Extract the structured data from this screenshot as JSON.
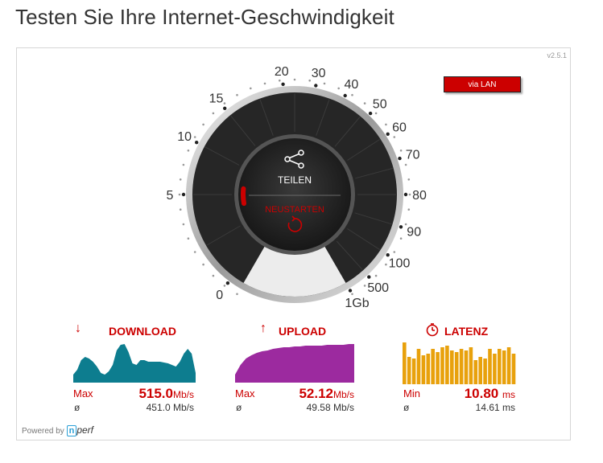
{
  "page": {
    "title": "Testen Sie Ihre Internet-Geschwindigkeit"
  },
  "panel": {
    "version": "v2.5.1",
    "connection_badge": "via LAN",
    "powered_by_label": "Powered by",
    "powered_by_brand": "nperf"
  },
  "gauge": {
    "scale_labels": [
      "0",
      "5",
      "10",
      "15",
      "20",
      "30",
      "40",
      "50",
      "60",
      "70",
      "80",
      "90",
      "100",
      "500",
      "1Gb"
    ],
    "share_label": "TEILEN",
    "restart_label": "NEUSTARTEN",
    "share_icon": "share-icon",
    "restart_icon": "restart-icon",
    "progress_fraction": 0.1,
    "colors": {
      "dial": "#262626",
      "bezel": "#d9d9d9",
      "accent": "#cc0000"
    }
  },
  "download": {
    "title": "DOWNLOAD",
    "icon": "arrow-down-icon",
    "stat_label": "Max",
    "value": "515.0",
    "unit": "Mb/s",
    "avg_symbol": "ø",
    "avg_value": "451.0 Mb/s",
    "color": "#0d7d8f"
  },
  "upload": {
    "title": "UPLOAD",
    "icon": "arrow-up-icon",
    "stat_label": "Max",
    "value": "52.12",
    "unit": "Mb/s",
    "avg_symbol": "ø",
    "avg_value": "49.58 Mb/s",
    "color": "#9c2a9f"
  },
  "latency": {
    "title": "LATENZ",
    "icon": "stopwatch-icon",
    "stat_label": "Min",
    "value": "10.80",
    "unit": "ms",
    "avg_symbol": "ø",
    "avg_value": "14.61 ms",
    "color": "#e8a10c"
  }
}
